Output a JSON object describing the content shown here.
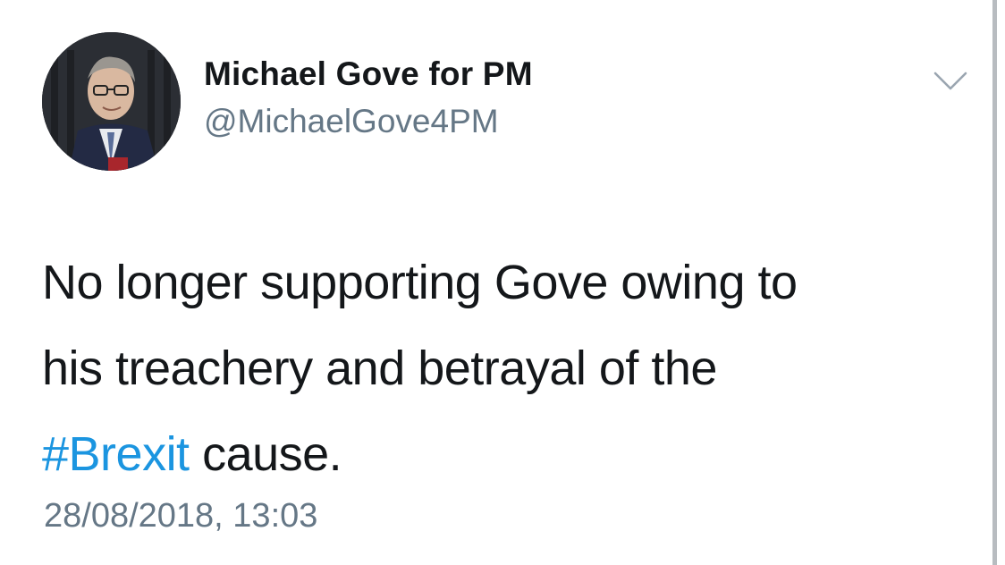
{
  "user": {
    "display_name": "Michael Gove for PM",
    "handle": "@MichaelGove4PM"
  },
  "tweet": {
    "line1": "No longer supporting Gove owing to",
    "line2": "his treachery and betrayal of the",
    "hashtag": "#Brexit",
    "line3_rest": " cause.",
    "timestamp": "28/08/2018, 13:03"
  },
  "icons": {
    "menu": "chevron-down-icon"
  },
  "colors": {
    "text": "#14171a",
    "secondary": "#657786",
    "link": "#1b95e0"
  }
}
